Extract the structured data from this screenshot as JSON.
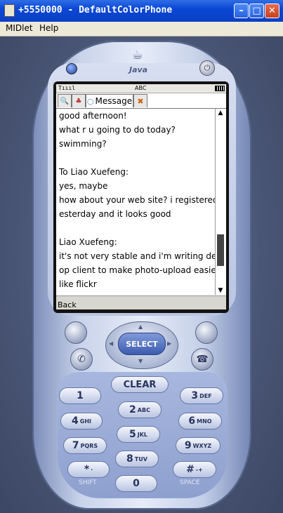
{
  "window": {
    "title": "+5550000 - DefaultColorPhone",
    "min_label": "–",
    "max_label": "□",
    "close_label": "✕"
  },
  "menu": {
    "items": [
      {
        "label": "MIDlet"
      },
      {
        "label": "Help"
      }
    ]
  },
  "phone": {
    "brand_word": "Java",
    "brand_icon": "java-cup-icon",
    "power_glyph": "⏻",
    "status": {
      "signal": "Tıııl",
      "input_mode": "ABC"
    },
    "tabs": [
      {
        "label": "",
        "icon": "search-user-icon"
      },
      {
        "label": "",
        "icon": "contacts-icon"
      },
      {
        "label": "Message",
        "icon": "chat-bubble-icon"
      },
      {
        "label": "",
        "icon": "tools-icon"
      }
    ],
    "messages": [
      "good afternoon!",
      "what r u going to do today?",
      "swimming?",
      "",
      "To Liao Xuefeng:",
      "yes, maybe",
      "how about your web site? i registered y",
      "esterday and it looks good",
      "",
      "Liao Xuefeng:",
      "it's not very stable and i'm writing deskt",
      "op client to make photo-upload easier",
      "like flickr"
    ],
    "scroll": {
      "up": "▲",
      "down": "▼",
      "position": 0.85
    },
    "soft_left": "Back",
    "select_label": "SELECT",
    "clear_label": "CLEAR",
    "keys": [
      {
        "num": "1",
        "letters": ""
      },
      {
        "num": "2",
        "letters": "ABC"
      },
      {
        "num": "3",
        "letters": "DEF"
      },
      {
        "num": "4",
        "letters": "GHI"
      },
      {
        "num": "5",
        "letters": "JKL"
      },
      {
        "num": "6",
        "letters": "MNO"
      },
      {
        "num": "7",
        "letters": "PQRS"
      },
      {
        "num": "8",
        "letters": "TUV"
      },
      {
        "num": "9",
        "letters": "WXYZ"
      },
      {
        "num": "*",
        "letters": "·"
      },
      {
        "num": "0",
        "letters": ""
      },
      {
        "num": "#",
        "letters": "-+"
      }
    ],
    "shift_label": "SHIFT",
    "space_label": "SPACE"
  },
  "colors": {
    "accent": "#0a47d6",
    "phone_blue": "#3c5cb0"
  }
}
